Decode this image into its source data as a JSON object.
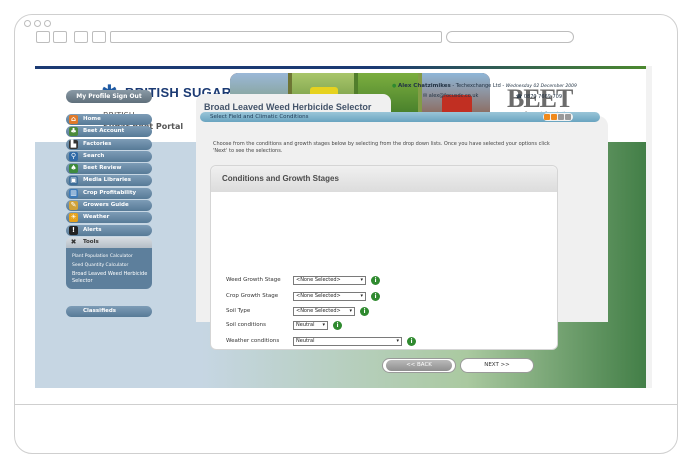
{
  "header": {
    "brand": "BRITISH SUGAR",
    "subtitle_line1": "BRITISH",
    "subtitle_line2": "Sugar Beet Portal",
    "partner_logo": "BEET",
    "partner_sub": "Research Organisation"
  },
  "user": {
    "name": "Alex Chatzimikes",
    "org": " - Techexchange Ltd - ",
    "date": "Wednesday 02 December 2009",
    "email": "alex@focusdc.co.uk",
    "phone": "0870 7669 709"
  },
  "sidebar": {
    "profile_label": "My Profile   Sign Out",
    "items": [
      {
        "label": "Home",
        "icon": "home-icon",
        "glyph": "⌂",
        "color": "#e07a2a"
      },
      {
        "label": "Beet Account",
        "icon": "beet-icon",
        "glyph": "♣",
        "color": "#4b8b3b"
      },
      {
        "label": "Factories",
        "icon": "factory-icon",
        "glyph": "▙",
        "color": "#333333"
      },
      {
        "label": "Search",
        "icon": "search-icon",
        "glyph": "⚲",
        "color": "#2f6aa6"
      },
      {
        "label": "Beet Review",
        "icon": "leaf-icon",
        "glyph": "♠",
        "color": "#3d8a3d"
      },
      {
        "label": "Media Libraries",
        "icon": "media-icon",
        "glyph": "▣",
        "color": "#3f6f9a"
      },
      {
        "label": "Crop Profitability",
        "icon": "chart-icon",
        "glyph": "▥",
        "color": "#3d7ab8"
      },
      {
        "label": "Growers Guide",
        "icon": "book-icon",
        "glyph": "✎",
        "color": "#d0a23a"
      },
      {
        "label": "Weather",
        "icon": "sun-icon",
        "glyph": "☀",
        "color": "#e6a11a"
      },
      {
        "label": "Alerts",
        "icon": "alert-icon",
        "glyph": "!",
        "color": "#222222"
      }
    ],
    "tools_label": "Tools",
    "tools_sub": [
      "Plant Population Calculator",
      "Seed Quantity Calculator"
    ],
    "tools_active": "Broad Leaved Weed Herbicide Selector",
    "classifieds_label": "Classifieds"
  },
  "main": {
    "page_title": "Broad Leaved Weed Herbicide Selector",
    "panel_header": "Select Field and Climatic Conditions",
    "intro": "Choose from the conditions and growth stages below by selecting from the drop down lists. Once you have selected your options click 'Next' to see the selections.",
    "section_title": "Conditions and Growth Stages",
    "fields": [
      {
        "label": "Weed Growth Stage",
        "value": "<None Selected>"
      },
      {
        "label": "Crop Growth Stage",
        "value": "<None Selected>"
      },
      {
        "label": "Soil Type",
        "value": "<None Selected>"
      },
      {
        "label": "Soil conditions",
        "value": "Neutral"
      },
      {
        "label": "Weather conditions",
        "value": "Neutral"
      }
    ],
    "back_label": "<< BACK",
    "next_label": "NEXT >>"
  }
}
